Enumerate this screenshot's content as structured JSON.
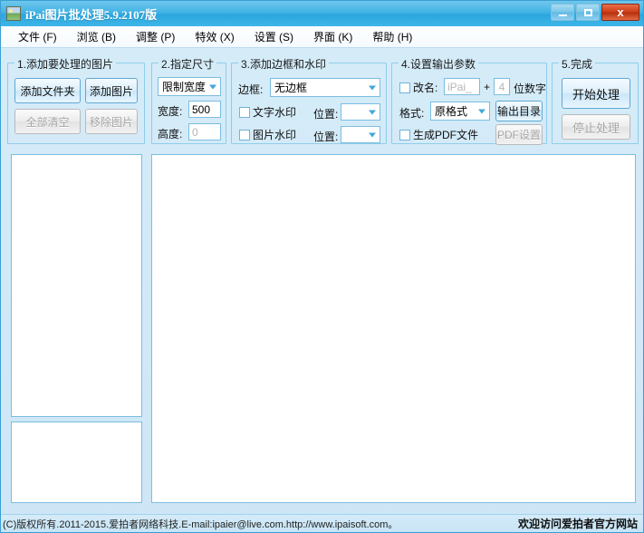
{
  "window": {
    "title": "iPai图片批处理5.9.2107版",
    "app_icon": "picture-icon",
    "buttons": {
      "minimize": "—",
      "maximize": "□",
      "close": "x"
    }
  },
  "menubar": [
    {
      "label": "文件 (F)",
      "name": "menu-file"
    },
    {
      "label": "浏览 (B)",
      "name": "menu-browse"
    },
    {
      "label": "调整 (P)",
      "name": "menu-adjust"
    },
    {
      "label": "特效 (X)",
      "name": "menu-effects"
    },
    {
      "label": "设置 (S)",
      "name": "menu-settings"
    },
    {
      "label": "界面 (K)",
      "name": "menu-interface"
    },
    {
      "label": "帮助 (H)",
      "name": "menu-help"
    }
  ],
  "group1": {
    "legend": "1.添加要处理的图片",
    "add_folder": "添加文件夹",
    "add_image": "添加图片",
    "clear_all": "全部清空",
    "remove_image": "移除图片"
  },
  "group2": {
    "legend": "2.指定尺寸",
    "mode_selected": "限制宽度",
    "width_label": "宽度:",
    "width_value": "500",
    "height_label": "高度:",
    "height_value": "0"
  },
  "group3": {
    "legend": "3.添加边框和水印",
    "border_label": "边框:",
    "border_selected": "无边框",
    "text_watermark": "文字水印",
    "text_position_label": "位置:",
    "text_position_value": "",
    "image_watermark": "图片水印",
    "image_position_label": "位置:",
    "image_position_value": ""
  },
  "group4": {
    "legend": "4.设置输出参数",
    "rename_label": "改名:",
    "rename_value": "iPai_",
    "plus": "+",
    "digits_value": "4",
    "digits_label": "位数字",
    "format_label": "格式:",
    "format_selected": "原格式",
    "output_dir": "输出目录",
    "make_pdf": "生成PDF文件",
    "pdf_settings": "PDF设置"
  },
  "group5": {
    "legend": "5.完成",
    "start": "开始处理",
    "stop": "停止处理"
  },
  "panels": {
    "file_list": "",
    "thumb_list": "",
    "preview": ""
  },
  "statusbar": {
    "copyright": "(C)版权所有.2011-2015.爱拍者网络科技.E-mail:ipaier@live.com.http://www.ipaisoft.com。",
    "website_link": "欢迎访问爱拍者官方网站"
  },
  "colors": {
    "title_bar": "#2aa6de",
    "close_button": "#cf3d18",
    "accent_border": "#8ecdeb",
    "window_bg": "#d4ebf8"
  }
}
